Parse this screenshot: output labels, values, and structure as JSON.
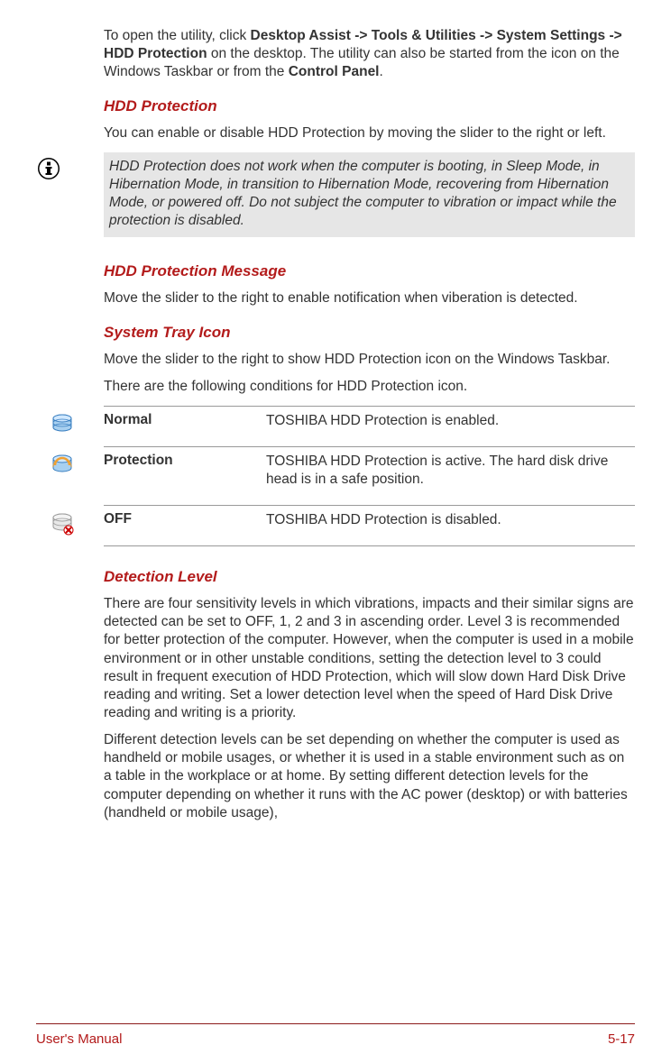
{
  "intro": {
    "prefix": "To open the utility, click ",
    "bold1": "Desktop Assist -> Tools & Utilities -> System Settings -> HDD Protection",
    "mid": " on the desktop. The utility can also be started from the icon on the Windows Taskbar or from the ",
    "bold2": "Control Panel",
    "suffix": "."
  },
  "sections": {
    "hdd_protection": {
      "heading": "HDD Protection",
      "para": "You can enable or disable HDD Protection by moving the slider to the right or left."
    },
    "note": "HDD Protection does not work when the computer is booting, in Sleep Mode, in Hibernation Mode, in transition to Hibernation Mode, recovering from Hibernation Mode, or powered off. Do not subject the computer to vibration or impact while the protection is disabled.",
    "hdd_protection_message": {
      "heading": "HDD Protection Message",
      "para": "Move the slider to the right to enable notification when viberation is detected."
    },
    "system_tray_icon": {
      "heading": "System Tray Icon",
      "para1": "Move the slider to the right to show HDD Protection icon on the Windows Taskbar.",
      "para2": "There are the following conditions for HDD Protection icon."
    },
    "icon_table": [
      {
        "label": "Normal",
        "desc": "TOSHIBA HDD Protection is enabled."
      },
      {
        "label": "Protection",
        "desc": "TOSHIBA HDD Protection is active. The hard disk drive head is in a safe position."
      },
      {
        "label": "OFF",
        "desc": "TOSHIBA HDD Protection is disabled."
      }
    ],
    "detection_level": {
      "heading": "Detection Level",
      "para1": "There are four sensitivity levels in which vibrations, impacts and their similar signs are detected can be set to OFF, 1, 2 and 3 in ascending order. Level 3 is recommended for better protection of the computer. However, when the computer is used in a mobile environment or in other unstable conditions, setting the detection level to 3 could result in frequent execution of HDD Protection, which will slow down Hard Disk Drive reading and writing. Set a lower detection level when the speed of Hard Disk Drive reading and writing is a priority.",
      "para2": "Different detection levels can be set depending on whether the computer is used as handheld or mobile usages, or whether it is used in a stable environment such as on a table in the workplace or at home. By setting different detection levels for the computer depending on whether it runs with the AC power (desktop) or with batteries (handheld or mobile usage),"
    }
  },
  "footer": {
    "left": "User's Manual",
    "right": "5-17"
  }
}
